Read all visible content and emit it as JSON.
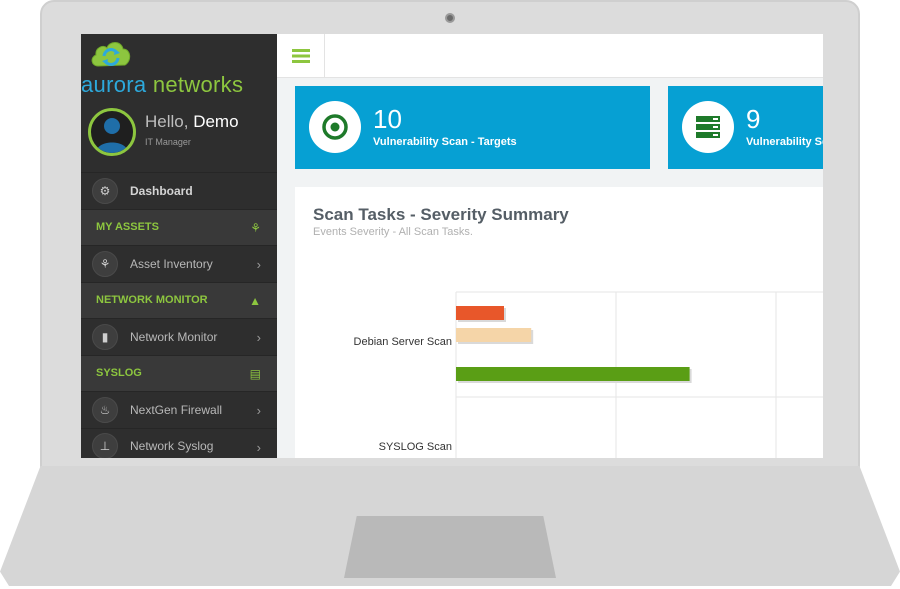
{
  "brand": {
    "name_part1": "aurora",
    "name_part2": " networks"
  },
  "profile": {
    "greeting": "Hello,",
    "username": " Demo",
    "role": "IT Manager"
  },
  "menu": [
    {
      "type": "item",
      "label": "Dashboard",
      "icon": "dashboard-icon",
      "glyph": "⚙",
      "chevron": false,
      "bold": true
    },
    {
      "type": "section",
      "label": "MY ASSETS",
      "icon": "cubes-icon",
      "glyph": "⚘"
    },
    {
      "type": "item",
      "label": "Asset Inventory",
      "icon": "cubes-icon",
      "glyph": "⚘",
      "chevron": true
    },
    {
      "type": "section",
      "label": "NETWORK MONITOR",
      "icon": "area-chart-icon",
      "glyph": "▲"
    },
    {
      "type": "item",
      "label": "Network Monitor",
      "icon": "bar-chart-icon",
      "glyph": "▮",
      "chevron": true
    },
    {
      "type": "section",
      "label": "SYSLOG",
      "icon": "file-icon",
      "glyph": "▤"
    },
    {
      "type": "item",
      "label": "NextGen Firewall",
      "icon": "fire-icon",
      "glyph": "♨",
      "chevron": true
    },
    {
      "type": "item",
      "label": "Network Syslog",
      "icon": "sitemap-icon",
      "glyph": "⊥",
      "chevron": true
    }
  ],
  "cards": [
    {
      "value": "10",
      "label": "Vulnerability Scan - Targets",
      "icon": "target-icon"
    },
    {
      "value": "9",
      "label": "Vulnerability Scans",
      "icon": "server-icon"
    }
  ],
  "panel": {
    "title": "Scan Tasks - Severity Summary",
    "subtitle": "Events Severity - All Scan Tasks."
  },
  "colors": {
    "accent": "#8dc63f",
    "card_blue": "#06a0d3",
    "high": "#e8572a",
    "low": "#f5d5a8",
    "log": "#5a9e15"
  },
  "chart_data": {
    "type": "bar",
    "orientation": "horizontal",
    "categories": [
      "Debian Server Scan",
      "SYSLOG Scan"
    ],
    "series": [
      {
        "color": "#e8572a",
        "values": [
          30,
          null
        ]
      },
      {
        "color": "#f5d5a8",
        "values": [
          47,
          null
        ]
      },
      {
        "color": "#5a9e15",
        "values": [
          146,
          null
        ]
      }
    ],
    "xlim": [
      0,
      200
    ],
    "grid": true
  }
}
